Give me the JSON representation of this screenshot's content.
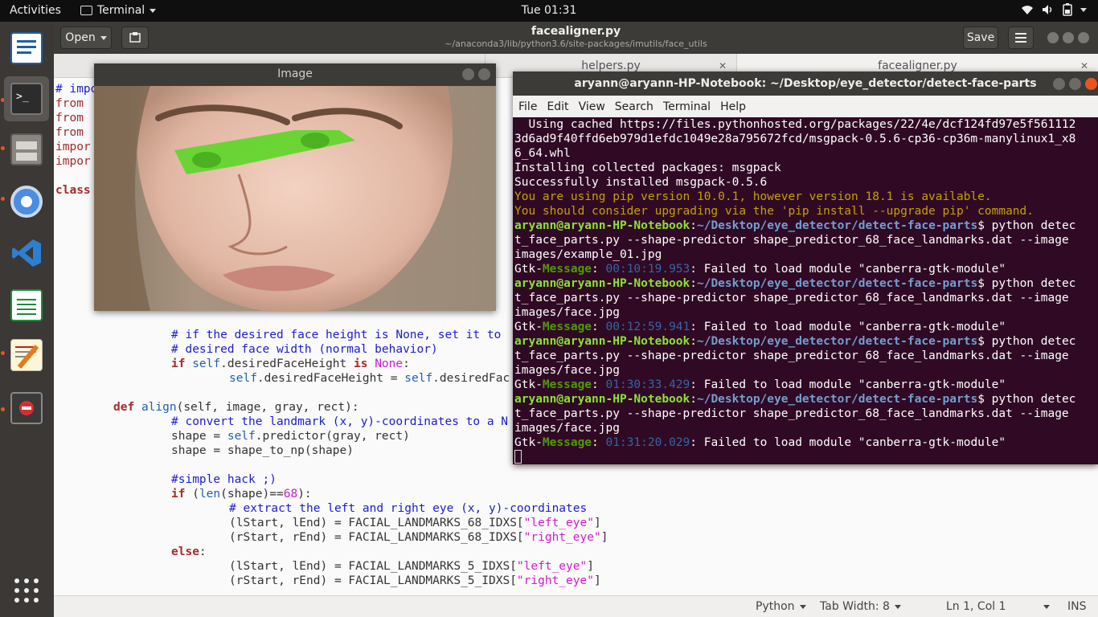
{
  "topbar": {
    "activities": "Activities",
    "app_name": "Terminal",
    "clock": "Tue 01:31"
  },
  "gedit": {
    "open_label": "Open",
    "title": "facealigner.py",
    "subtitle": "~/anaconda3/lib/python3.6/site-packages/imutils/face_utils",
    "save_label": "Save",
    "tabs": [
      "helpers.py",
      "facealigner.py"
    ],
    "status": {
      "language": "Python",
      "tab_width": "Tab Width: 8",
      "position": "Ln 1, Col 1",
      "mode": "INS"
    }
  },
  "image_window": {
    "title": "Image"
  },
  "terminal": {
    "title": "aryann@aryann-HP-Notebook: ~/Desktop/eye_detector/detect-face-parts",
    "menu": [
      "File",
      "Edit",
      "View",
      "Search",
      "Terminal",
      "Help"
    ],
    "prompt_user": "aryann@aryann-HP-Notebook",
    "prompt_path": "~/Desktop/eye_detector/detect-face-parts",
    "lines": {
      "l1": "  Using cached https://files.pythonhosted.org/packages/22/4e/dcf124fd97e5f561112",
      "l2": "3d6ad9f40ffd6eb979d1efdc1049e28a795672fcd/msgpack-0.5.6-cp36-cp36m-manylinux1_x8",
      "l3": "6_64.whl",
      "l4": "Installing collected packages: msgpack",
      "l5": "Successfully installed msgpack-0.5.6",
      "l6": "You are using pip version 10.0.1, however version 18.1 is available.",
      "l7": "You should consider upgrading via the 'pip install --upgrade pip' command.",
      "cmd1_a": "$ python detec",
      "cmd1_b": "t_face_parts.py --shape-predictor shape_predictor_68_face_landmarks.dat --image",
      "cmd1_c": "images/example_01.jpg",
      "cmd2_c": "images/face.jpg",
      "gtk_label": "Gtk-",
      "gtk_msg": "Message",
      "gtk_text": ": Failed to load module \"canberra-gtk-module\"",
      "t1": "00:10:19.953",
      "t2": "00:12:59.941",
      "t3": "01:30:33.429",
      "t4": "01:31:20.029"
    }
  },
  "code": {
    "c1": "# impo",
    "c2": "from",
    "c3": "from",
    "c4": "from",
    "c5": "impor",
    "c6": "impor",
    "c7": "class",
    "l_if_comment1": "# if the desired face height is None, set it to",
    "l_if_comment2": "# desired face width (normal behavior)",
    "l_if": "if",
    "l_self": "self",
    "l_attr1": ".desiredFaceHeight ",
    "l_is": "is",
    "l_none": "None",
    "l_colon": ":",
    "l_assign_a": ".desiredFaceHeight = ",
    "l_assign_b": ".desiredFac",
    "def": "def",
    "align": "align",
    "align_args": "(self, image, gray, rect):",
    "convert_comment": "# convert the landmark (x, y)-coordinates to a N",
    "shape1_a": "shape = ",
    "shape1_b": ".predictor(gray, rect)",
    "shape2": "shape = shape_to_np(shape)",
    "hack": "#simple hack ;)",
    "len_a": " (",
    "len_fn": "len",
    "len_b": "(shape)==",
    "len_n": "68",
    "len_c": "):",
    "extract_comment": "# extract the left and right eye (x, y)-coordinates",
    "l68_a": "(lStart, lEnd) = FACIAL_LANDMARKS_68_IDXS[",
    "l68_s": "\"left_eye\"",
    "r68_a": "(rStart, rEnd) = FACIAL_LANDMARKS_68_IDXS[",
    "r68_s": "\"right_eye\"",
    "close_br": "]",
    "else": "else",
    "l5_a": "(lStart, lEnd) = FACIAL_LANDMARKS_5_IDXS[",
    "r5_a": "(rStart, rEnd) = FACIAL_LANDMARKS_5_IDXS["
  },
  "colors": {
    "terminal_bg": "#300a24",
    "prompt_green": "#8ae234",
    "path_blue": "#729fcf",
    "overlay_green": "#5fd62a"
  }
}
